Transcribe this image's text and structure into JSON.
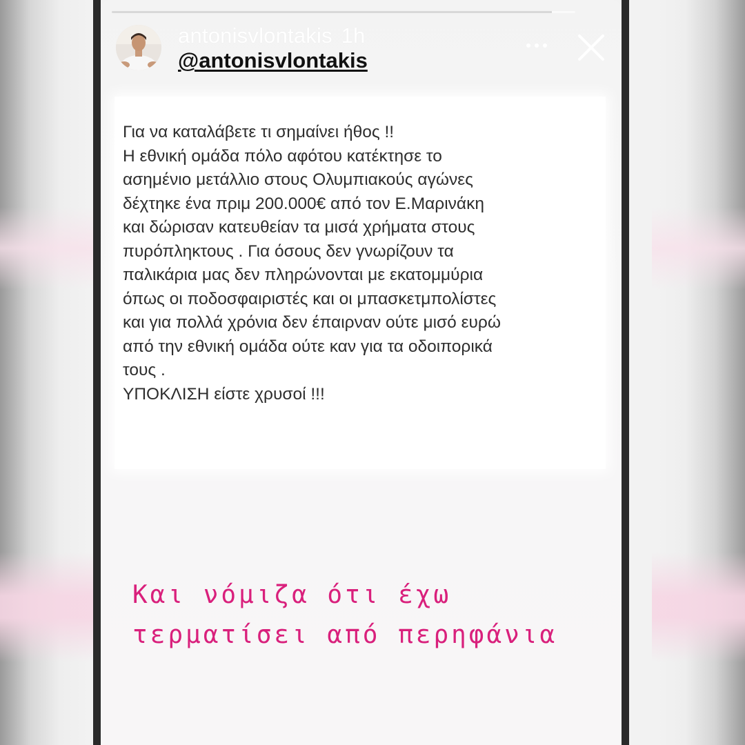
{
  "story": {
    "progress": 0.95,
    "user": {
      "username": "antonisvlontakis",
      "timestamp": "1h",
      "avatar_icon": "profile-photo-avatar"
    },
    "mention": "@antonisvlontakis",
    "controls": {
      "more_icon": "ellipsis-icon",
      "close_icon": "close-icon"
    },
    "post_text": {
      "lines": [
        "Για να καταλάβετε τι σημαίνει ήθος !!",
        "Η εθνική ομάδα πόλο αφότου κατέκτησε το",
        "ασημένιο μετάλλιο στους Ολυμπιακούς αγώνες",
        "δέχτηκε ένα πριμ 200.000€ από τον Ε.Μαρινάκη",
        "και δώρισαν κατευθείαν τα μισά χρήματα στους",
        "πυρόπληκτους . Για όσους δεν γνωρίζουν τα",
        "παλικάρια μας δεν πληρώνονται με εκατομμύρια",
        "όπως οι ποδοσφαιριστές και οι μπασκετμπολίστες",
        "και για πολλά χρόνια δεν έπαιρναν ούτε μισό ευρώ",
        "από την εθνική ομάδα ούτε καν για τα οδοιπορικά",
        "τους .",
        "ΥΠΟΚΛΙΣΗ είστε χρυσοί !!!"
      ]
    },
    "caption": {
      "lines": [
        "Και νόμιζα ότι έχω",
        "τερματίσει από περηφάνια"
      ],
      "color": "#d9207c"
    }
  }
}
